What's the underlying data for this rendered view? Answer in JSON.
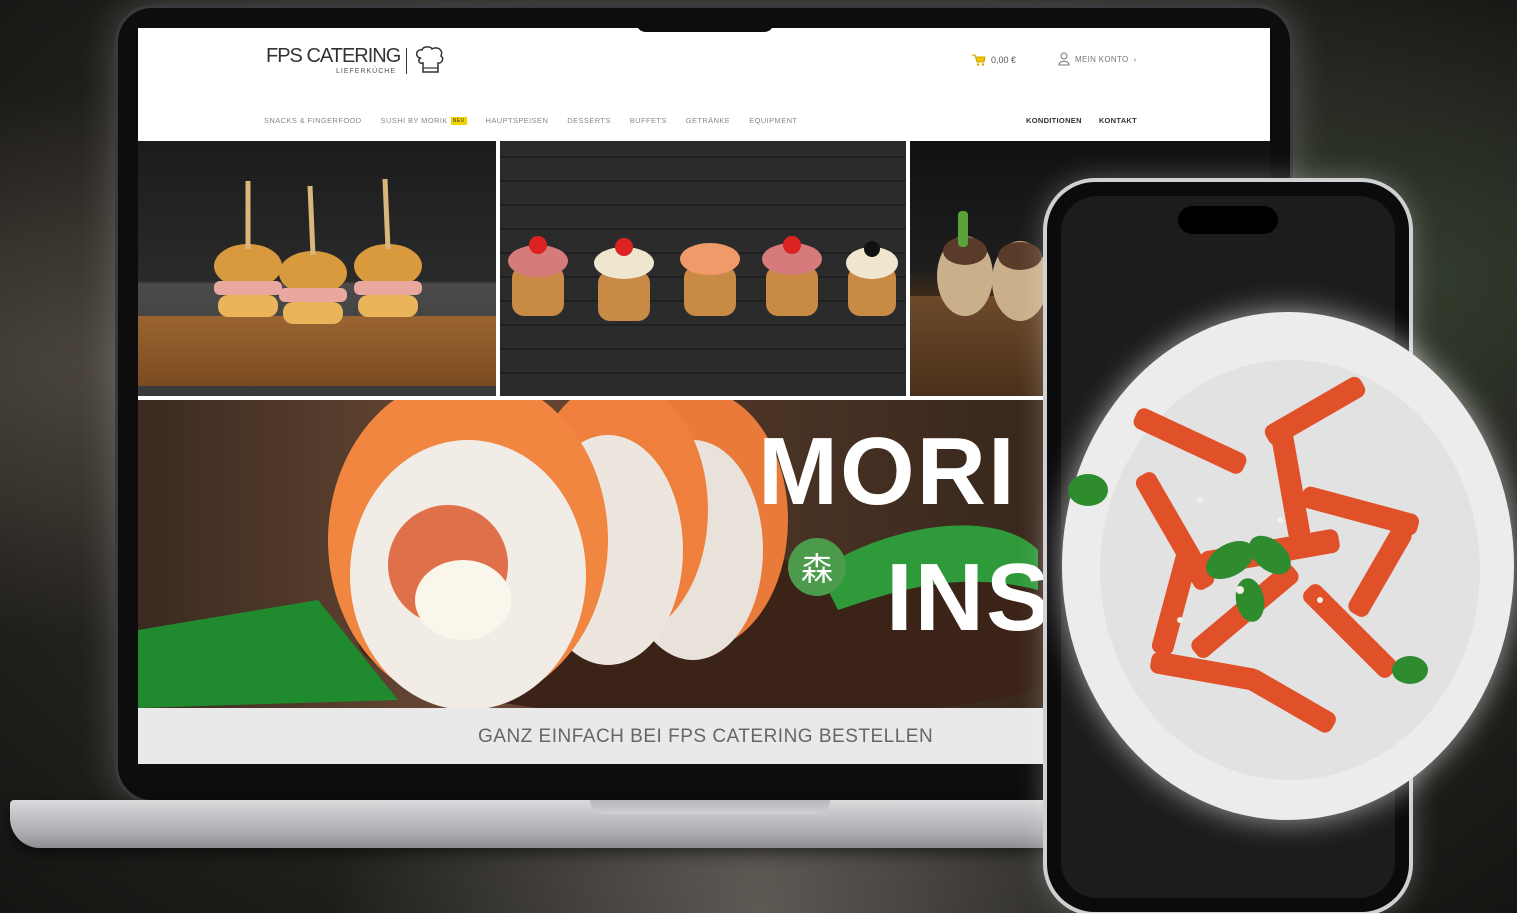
{
  "site": {
    "logo_text": "FPS CATERING",
    "logo_sub": "LIEFERKÜCHE",
    "cart_total": "0,00 €",
    "account_label": "MEIN KONTO",
    "account_chevron": "›"
  },
  "nav": {
    "items": [
      {
        "label": "SNACKS & FINGERFOOD"
      },
      {
        "label": "SUSHI BY MORIK",
        "badge": "NEU"
      },
      {
        "label": "HAUPTSPEISEN"
      },
      {
        "label": "DESSERTS"
      },
      {
        "label": "BUFFETS"
      },
      {
        "label": "GETRÄNKE"
      },
      {
        "label": "EQUIPMENT"
      }
    ],
    "right": [
      "KONDITIONEN",
      "KONTAKT"
    ]
  },
  "hero": {
    "title_line1": "MORI",
    "title_line2": "INS",
    "emblem_glyph": "森"
  },
  "banner": {
    "text": "GANZ EINFACH BEI FPS CATERING BESTELLEN"
  },
  "icons": {
    "cart": "cart-icon",
    "user": "user-icon",
    "chef_hat": "chef-hat-icon"
  },
  "colors": {
    "badge": "#f2d500",
    "emblem_green": "#4c9b4c",
    "banner_bg": "#e9e9ea"
  }
}
